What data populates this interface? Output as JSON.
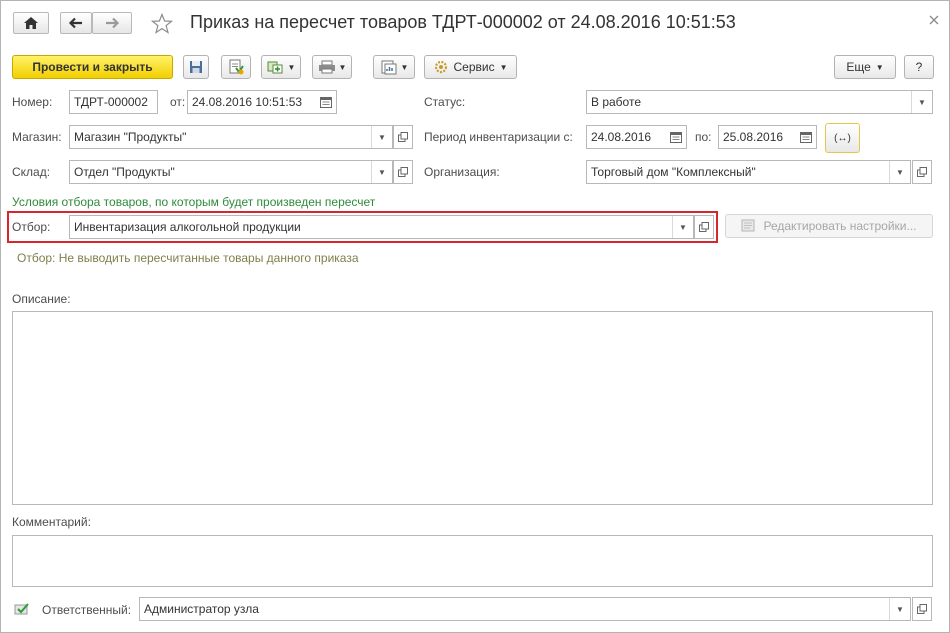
{
  "window": {
    "title": "Приказ на пересчет товаров ТДРТ-000002 от 24.08.2016 10:51:53"
  },
  "icons": {
    "home": "home-icon",
    "back": "arrow-left-icon",
    "forward": "arrow-right-icon",
    "favorite": "star-icon",
    "save": "floppy-disk-icon",
    "post": "document-post-icon",
    "create_based": "create-based-on-icon",
    "print": "printer-icon",
    "reports": "reports-icon",
    "service": "gear-icon",
    "calendar": "calendar-icon",
    "open": "open-form-icon",
    "period": "period-select-icon",
    "edit_settings": "settings-edit-icon",
    "responsible": "responsible-check-icon"
  },
  "toolbar": {
    "post_close_label": "Провести и закрыть",
    "service_label": "Сервис",
    "more_label": "Еще",
    "help_label": "?"
  },
  "form": {
    "number_label": "Номер:",
    "number_value": "ТДРТ-000002",
    "date_label": "от:",
    "date_value": "24.08.2016 10:51:53",
    "status_label": "Статус:",
    "status_value": "В работе",
    "store_label": "Магазин:",
    "store_value": "Магазин \"Продукты\"",
    "period_label": "Период инвентаризации с:",
    "period_from": "24.08.2016",
    "period_to_label": "по:",
    "period_to": "25.08.2016",
    "period_button": "(↔)",
    "warehouse_label": "Склад:",
    "warehouse_value": "Отдел \"Продукты\"",
    "org_label": "Организация:",
    "org_value": "Торговый дом \"Комплексный\"",
    "conditions_text": "Условия отбора товаров, по которым будет произведен пересчет",
    "filter_label": "Отбор:",
    "filter_value": "Инвентаризация алкогольной продукции",
    "edit_settings_label": "Редактировать настройки...",
    "filter_note": "Отбор: Не выводить пересчитанные товары данного приказа",
    "description_label": "Описание:",
    "comment_label": "Комментарий:",
    "responsible_label": "Ответственный:",
    "responsible_value": "Администратор узла"
  },
  "colors": {
    "primary_button": "#f5d400",
    "highlight_border": "#d9262e",
    "green_text": "#2e8b3a"
  }
}
